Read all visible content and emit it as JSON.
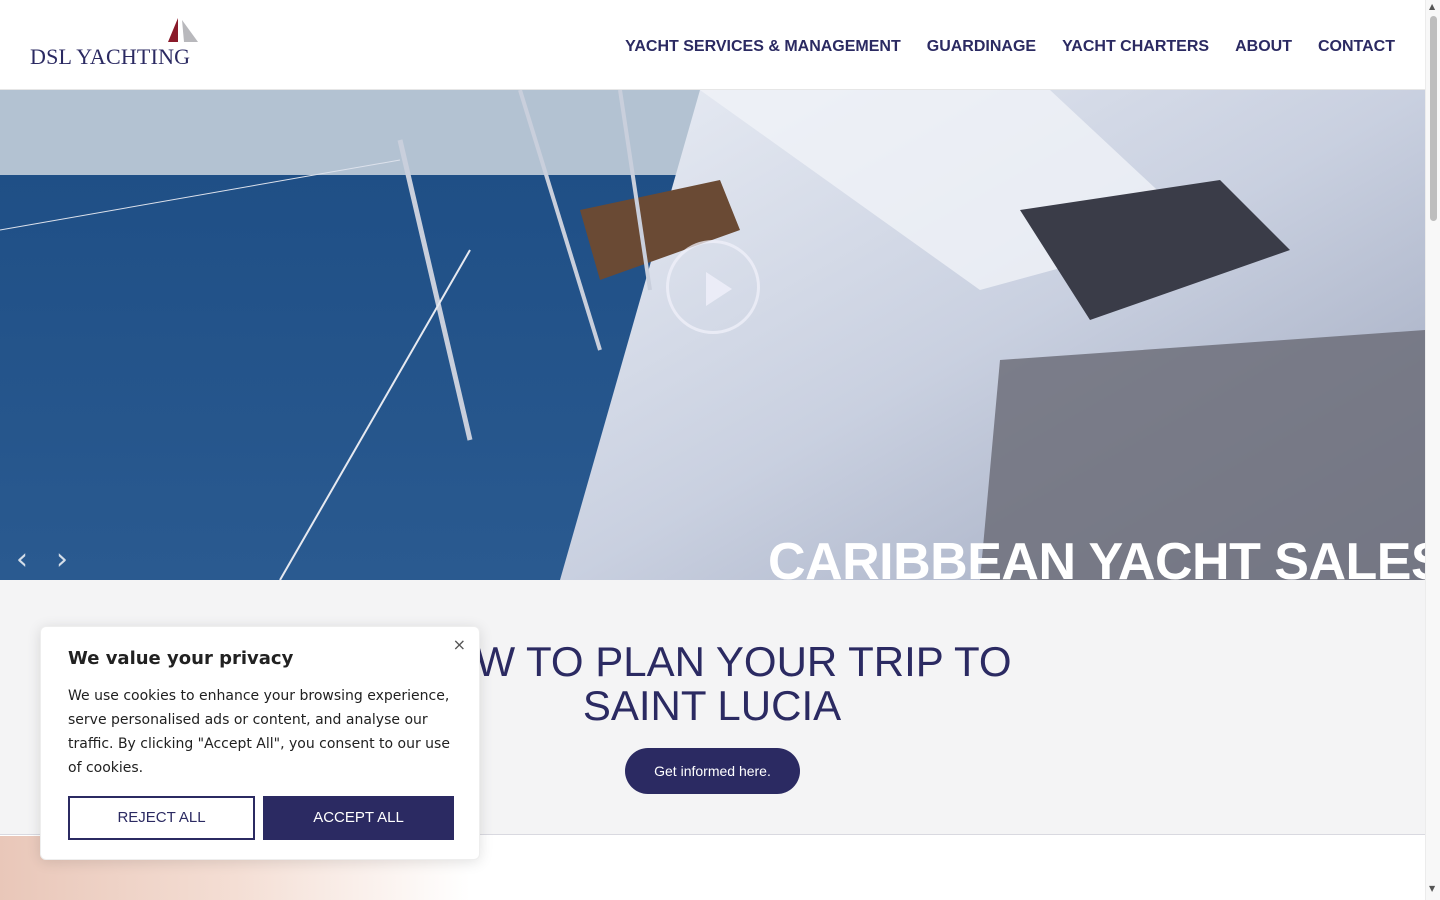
{
  "brand": {
    "name": "DSL YACHTING",
    "primary_color": "#2b2a62",
    "accent_color": "#8a1a2a"
  },
  "nav": {
    "items": [
      {
        "label": "YACHT SERVICES & MANAGEMENT"
      },
      {
        "label": "GUARDINAGE"
      },
      {
        "label": "YACHT CHARTERS"
      },
      {
        "label": "ABOUT"
      },
      {
        "label": "CONTACT"
      }
    ]
  },
  "hero": {
    "title": "CARIBBEAN YACHT SALES",
    "prev_icon": "chevron-left-icon",
    "next_icon": "chevron-right-icon",
    "play_icon": "play-icon"
  },
  "promo": {
    "title": "HOW TO PLAN YOUR TRIP TO SAINT LUCIA",
    "button_label": "Get informed here."
  },
  "cookie": {
    "title": "We value your privacy",
    "body": "We use cookies to enhance your browsing experience, serve personalised ads or content, and analyse our traffic. By clicking \"Accept All\", you consent to our use of cookies.",
    "reject_label": "REJECT ALL",
    "accept_label": "ACCEPT ALL",
    "close_glyph": "×"
  }
}
